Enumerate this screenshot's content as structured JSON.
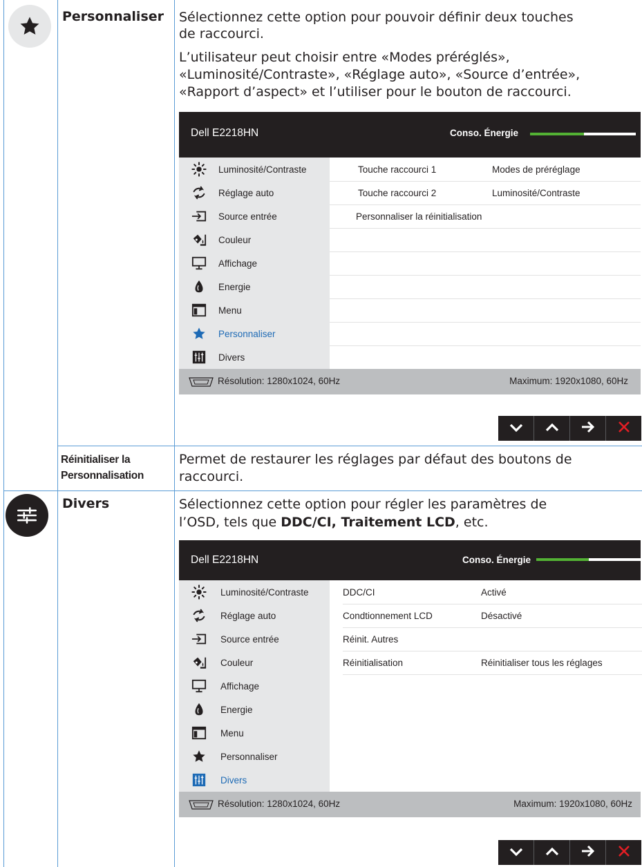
{
  "personnaliser": {
    "icon": "star-icon",
    "label": "Personnaliser",
    "desc_lines": [
      "Sélectionnez cette option pour pouvoir définir deux touches",
      "de raccourci.",
      "L’utilisateur peut choisir entre «Modes préréglés»,",
      "«Luminosité/Contraste», «Réglage auto», «Source d’entrée»,",
      "«Rapport d’aspect» et l’utiliser pour le bouton de raccourci."
    ]
  },
  "reset": {
    "label_line1": "Réinitialiser la",
    "label_line2": "Personnalisation",
    "desc_line1": "Permet de restaurer les réglages par défaut des boutons de",
    "desc_line2": "raccourci."
  },
  "divers": {
    "icon": "sliders-icon",
    "label": "Divers",
    "desc_line1": "Sélectionnez cette option pour régler les paramètres de",
    "desc_line2_pre": "l’OSD, tels que ",
    "desc_line2_bold": "DDC/CI, Traitement LCD",
    "desc_line2_post": ", etc."
  },
  "osd1": {
    "model": "Dell E2218HN",
    "energy_label": "Conso. Énergie",
    "energy_level": 0.5,
    "menu": [
      {
        "label": "Luminosité/Contraste",
        "icon": "brightness-icon"
      },
      {
        "label": "Réglage auto",
        "icon": "auto-adjust-icon"
      },
      {
        "label": "Source entrée",
        "icon": "input-source-icon"
      },
      {
        "label": "Couleur",
        "icon": "color-icon"
      },
      {
        "label": "Affichage",
        "icon": "display-icon"
      },
      {
        "label": "Energie",
        "icon": "energy-icon"
      },
      {
        "label": "Menu",
        "icon": "menu-icon"
      },
      {
        "label": "Personnaliser",
        "icon": "star-icon"
      },
      {
        "label": "Divers",
        "icon": "sliders-icon"
      }
    ],
    "active_index": 7,
    "rows": [
      {
        "name": "Touche raccourci 1",
        "value": "Modes de préréglage"
      },
      {
        "name": "Touche raccourci 2",
        "value": "Luminosité/Contraste"
      },
      {
        "name": "Personnaliser la réinitialisation",
        "value": ""
      }
    ],
    "resolution": "Résolution: 1280x1024, 60Hz",
    "maximum": "Maximum: 1920x1080, 60Hz"
  },
  "osd2": {
    "model": "Dell E2218HN",
    "energy_label": "Conso. Énergie",
    "energy_level": 0.5,
    "menu": [
      {
        "label": "Luminosité/Contraste",
        "icon": "brightness-icon"
      },
      {
        "label": "Réglage auto",
        "icon": "auto-adjust-icon"
      },
      {
        "label": "Source entrée",
        "icon": "input-source-icon"
      },
      {
        "label": "Couleur",
        "icon": "color-icon"
      },
      {
        "label": "Affichage",
        "icon": "display-icon"
      },
      {
        "label": "Energie",
        "icon": "energy-icon"
      },
      {
        "label": "Menu",
        "icon": "menu-icon"
      },
      {
        "label": "Personnaliser",
        "icon": "star-icon"
      },
      {
        "label": "Divers",
        "icon": "sliders-icon"
      }
    ],
    "active_index": 8,
    "rows": [
      {
        "name": "DDC/CI",
        "value": "Activé"
      },
      {
        "name": "Condtionnement LCD",
        "value": "Désactivé"
      },
      {
        "name": "Réinit. Autres",
        "value": ""
      },
      {
        "name": "Réinitialisation",
        "value": "Réinitialiser tous les réglages"
      }
    ],
    "resolution": "Résolution: 1280x1024, 60Hz",
    "maximum": "Maximum: 1920x1080, 60Hz"
  },
  "buttons": [
    {
      "icon": "chevron-down-icon"
    },
    {
      "icon": "chevron-up-icon"
    },
    {
      "icon": "arrow-right-icon"
    },
    {
      "icon": "close-icon"
    }
  ],
  "colors": {
    "border": "#5a9bd5",
    "osd_header": "#231f20",
    "osd_sidebar": "#e6e7e8",
    "osd_footer": "#bcbec0",
    "energy_bar": "#53b234",
    "active_item": "#1d6ab5",
    "close_red": "#e31e24"
  }
}
